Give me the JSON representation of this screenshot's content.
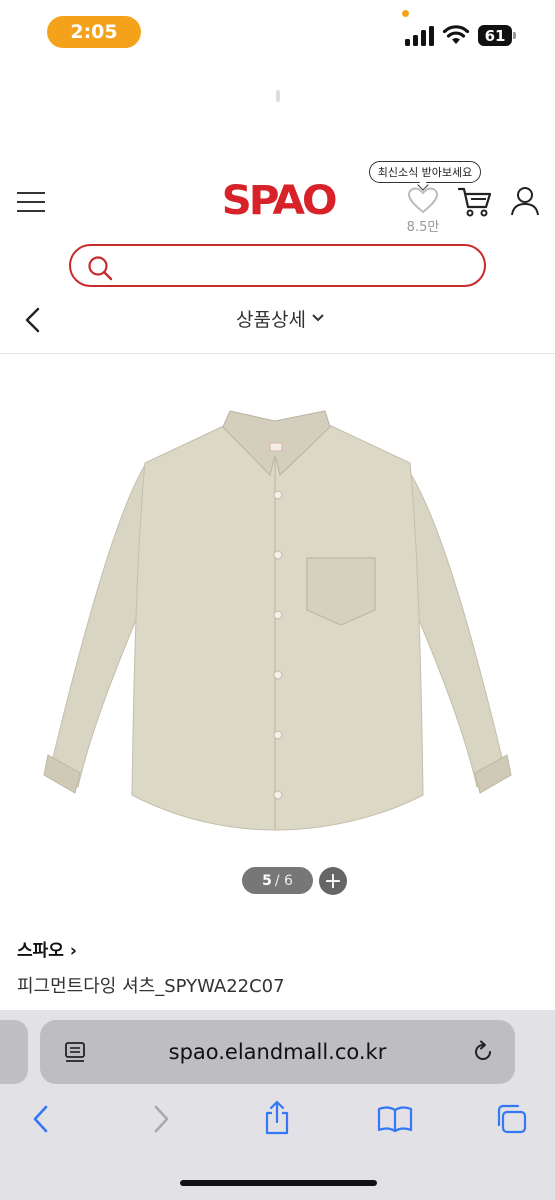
{
  "status_bar": {
    "time": "2:05",
    "battery": "61"
  },
  "header": {
    "logo": "SPAO",
    "tooltip": "최신소식 받아보세요",
    "wish_count": "8.5만"
  },
  "search": {
    "placeholder": ""
  },
  "page": {
    "title": "상품상세"
  },
  "gallery": {
    "current": "5",
    "total": "/ 6",
    "zoom_label": "+"
  },
  "product": {
    "brand": "스파오 ›",
    "name": "피그먼트다잉 셔츠_SPYWA22C07"
  },
  "browser": {
    "url": "spao.elandmall.co.kr"
  },
  "colors": {
    "accent": "#d8222a",
    "status_pill": "#f4a21a",
    "ios_blue": "#3478f6",
    "shirt": "#d9d5c3"
  }
}
